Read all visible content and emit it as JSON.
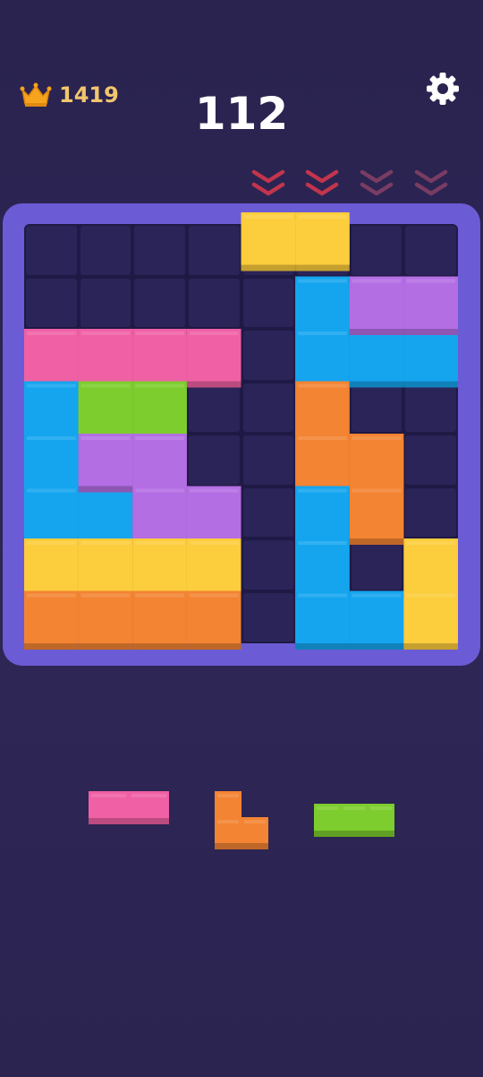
{
  "header": {
    "best_score": "1419",
    "score": "112",
    "best_icon": "crown-icon",
    "settings_icon": "gear-icon"
  },
  "colors": {
    "background": "#2a2350",
    "board_frame": "#6b5bd4",
    "board": "#1f1a45",
    "cell": "#2a2458",
    "yellow": "#fccd3c",
    "pink": "#f060a4",
    "blue": "#15a5ef",
    "green": "#7dcd2e",
    "purple": "#b46ee4",
    "orange": "#f38433",
    "chevron_bright": "#c2354c",
    "chevron_dim": "#7a3c63"
  },
  "grid": {
    "cols": 8,
    "rows": 8
  },
  "drop_indicators": [
    {
      "column": 5,
      "style": "bright"
    },
    {
      "column": 6,
      "style": "bright"
    },
    {
      "column": 7,
      "style": "dim"
    },
    {
      "column": 8,
      "style": "dim"
    }
  ],
  "board_pieces": [
    {
      "name": "yellow-bar-top",
      "color": "yellow",
      "cells": [
        [
          0,
          4
        ],
        [
          0,
          5
        ]
      ]
    },
    {
      "name": "blue-l-piece-right",
      "color": "blue",
      "cells": [
        [
          1,
          5
        ],
        [
          2,
          5
        ],
        [
          2,
          6
        ],
        [
          2,
          7
        ]
      ]
    },
    {
      "name": "purple-bar-right",
      "color": "purple",
      "cells": [
        [
          1,
          6
        ],
        [
          1,
          7
        ]
      ]
    },
    {
      "name": "pink-bar",
      "color": "pink",
      "cells": [
        [
          2,
          0
        ],
        [
          2,
          1
        ],
        [
          2,
          2
        ],
        [
          2,
          3
        ]
      ]
    },
    {
      "name": "blue-l-piece-left",
      "color": "blue",
      "cells": [
        [
          3,
          0
        ],
        [
          4,
          0
        ],
        [
          5,
          0
        ],
        [
          5,
          1
        ]
      ]
    },
    {
      "name": "green-bar",
      "color": "green",
      "cells": [
        [
          3,
          1
        ],
        [
          3,
          2
        ]
      ]
    },
    {
      "name": "purple-s-piece",
      "color": "purple",
      "cells": [
        [
          4,
          1
        ],
        [
          4,
          2
        ],
        [
          5,
          2
        ],
        [
          5,
          3
        ]
      ]
    },
    {
      "name": "orange-s-piece",
      "color": "orange",
      "cells": [
        [
          3,
          5
        ],
        [
          4,
          5
        ],
        [
          4,
          6
        ],
        [
          5,
          6
        ]
      ]
    },
    {
      "name": "blue-l-piece-bottom",
      "color": "blue",
      "cells": [
        [
          5,
          5
        ],
        [
          6,
          5
        ],
        [
          7,
          5
        ],
        [
          7,
          6
        ]
      ]
    },
    {
      "name": "yellow-bar-bottom",
      "color": "yellow",
      "cells": [
        [
          6,
          0
        ],
        [
          6,
          1
        ],
        [
          6,
          2
        ],
        [
          6,
          3
        ]
      ]
    },
    {
      "name": "orange-bar-bottom",
      "color": "orange",
      "cells": [
        [
          7,
          0
        ],
        [
          7,
          1
        ],
        [
          7,
          2
        ],
        [
          7,
          3
        ]
      ]
    },
    {
      "name": "yellow-vertical-bar",
      "color": "yellow",
      "cells": [
        [
          6,
          7
        ],
        [
          7,
          7
        ]
      ]
    }
  ],
  "tray": [
    {
      "name": "tray-pink-block",
      "color": "pink",
      "cells": [
        [
          0,
          0
        ],
        [
          0,
          1
        ]
      ],
      "shape": "1x2 block"
    },
    {
      "name": "tray-orange-corner",
      "color": "orange",
      "cells": [
        [
          0,
          0
        ],
        [
          1,
          0
        ],
        [
          1,
          1
        ]
      ],
      "shape": "L corner"
    },
    {
      "name": "tray-green-bar",
      "color": "green",
      "cells": [
        [
          0,
          0
        ],
        [
          0,
          1
        ],
        [
          0,
          2
        ]
      ],
      "shape": "1x3 bar"
    }
  ]
}
